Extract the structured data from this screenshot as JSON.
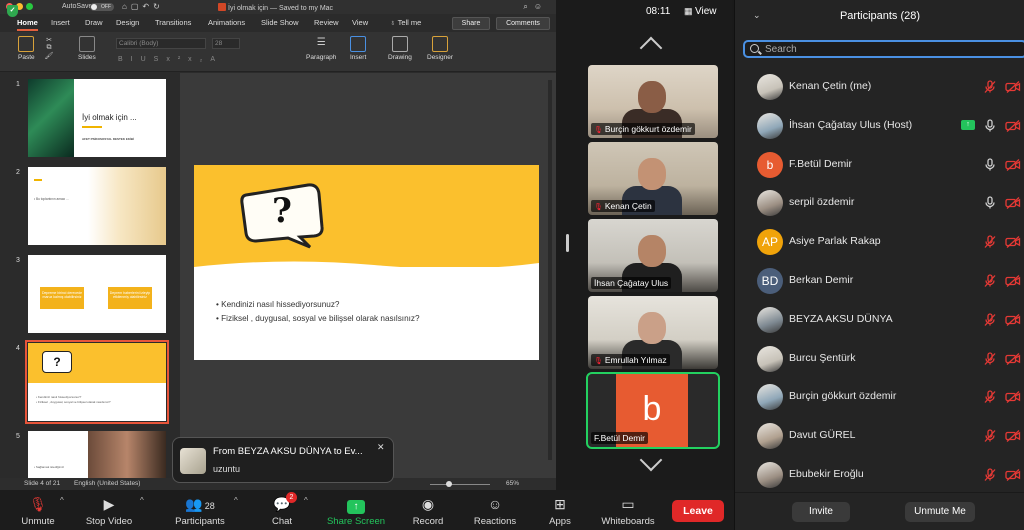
{
  "ppt": {
    "autosave": "AutoSave",
    "autosave_state": "OFF",
    "doc_title": "İyi olmak için",
    "save_status": "— Saved to my Mac",
    "tabs": [
      "Home",
      "Insert",
      "Draw",
      "Design",
      "Transitions",
      "Animations",
      "Slide Show",
      "Review",
      "View",
      "Tell me"
    ],
    "share_label": "Share",
    "comments_label": "Comments",
    "ribbon": {
      "paste": "Paste",
      "slides": "Slides",
      "font_name": "Calibri (Body)",
      "font_size": "28",
      "paragraph": "Paragraph",
      "insert": "Insert",
      "drawing": "Drawing",
      "designer": "Designer"
    },
    "thumbnails": {
      "numbers": [
        "1",
        "2",
        "3",
        "4",
        "5"
      ],
      "t1_title": "İyi olmak için ...",
      "t1_sub": "AFET PSİKOSOSYAL DESTEK EKİBİ",
      "t2_text": "• Bu toplantının amacı ...",
      "t3_box1": "Depreme birinci derecede maruz kalmış olabilirsiniz",
      "t3_box2": "Deprem haberlerini izleyip etkilenmiş olabilirsiniz",
      "t4_q": "?",
      "t4_line1": "• Kendinizi nasıl hissediyorsunuz?",
      "t4_line2": "• Fiziksel , duygusal, sosyal ve bilişsel olarak nasılsınız?",
      "t5_text": "• Sağlamak istediğimiz"
    },
    "slide": {
      "question_mark": "?",
      "bullet1": "Kendinizi nasıl hissediyorsunuz?",
      "bullet2": "Fiziksel , duygusal, sosyal ve bilişsel olarak nasılsınız?"
    },
    "status": {
      "slide_of": "Slide 4 of 21",
      "language": "English (United States)",
      "zoom": "65%"
    }
  },
  "toast": {
    "from": "From BEYZA AKSU DÜNYA to Ev...",
    "message": "uzuntu",
    "close": "✕"
  },
  "zoom": {
    "clock": "08:11",
    "view": "View",
    "tiles": [
      {
        "name": "Burçin gökkurt özdemir"
      },
      {
        "name": "Kenan Çetin"
      },
      {
        "name": "İhsan Çağatay Ulus"
      },
      {
        "name": "Emrullah Yılmaz"
      },
      {
        "name": "F.Betül Demir",
        "initial": "b"
      }
    ],
    "bottom": {
      "unmute": "Unmute",
      "stop_video": "Stop Video",
      "participants": "Participants",
      "participants_count": "28",
      "chat": "Chat",
      "chat_badge": "2",
      "share_screen": "Share Screen",
      "record": "Record",
      "reactions": "Reactions",
      "apps": "Apps",
      "whiteboards": "Whiteboards",
      "leave": "Leave"
    }
  },
  "panel": {
    "title": "Participants (28)",
    "search_placeholder": "Search",
    "participants": [
      {
        "name": "Kenan Çetin (me)",
        "avatar": "photo",
        "mic": "muted",
        "cam": "off"
      },
      {
        "name": "İhsan Çağatay Ulus (Host)",
        "avatar": "photo",
        "mic": "on",
        "cam": "off",
        "share": true
      },
      {
        "name": "F.Betül Demir",
        "avatar": "b",
        "color": "#e75b31",
        "mic": "on",
        "cam": "off"
      },
      {
        "name": "serpil özdemir",
        "avatar": "photo",
        "mic": "on",
        "cam": "off"
      },
      {
        "name": "Asiye Parlak Rakap",
        "avatar": "AP",
        "color": "#f0a30a",
        "mic": "muted",
        "cam": "off"
      },
      {
        "name": "Berkan Demir",
        "avatar": "BD",
        "color": "#4b5e7a",
        "mic": "muted",
        "cam": "off"
      },
      {
        "name": "BEYZA AKSU DÜNYA",
        "avatar": "photo",
        "mic": "muted",
        "cam": "off"
      },
      {
        "name": "Burcu Şentürk",
        "avatar": "photo",
        "mic": "muted",
        "cam": "off"
      },
      {
        "name": "Burçin gökkurt özdemir",
        "avatar": "photo",
        "mic": "muted",
        "cam": "off"
      },
      {
        "name": "Davut GÜREL",
        "avatar": "photo",
        "mic": "muted",
        "cam": "off"
      },
      {
        "name": "Ebubekir Eroğlu",
        "avatar": "photo",
        "mic": "muted",
        "cam": "off"
      }
    ],
    "invite": "Invite",
    "unmute_me": "Unmute Me"
  },
  "colors": {
    "accent_green": "#23c45c",
    "leave_red": "#e02828",
    "muted_red": "#e53935",
    "slide_yellow": "#fbc02d",
    "search_blue": "#4a90e2"
  }
}
